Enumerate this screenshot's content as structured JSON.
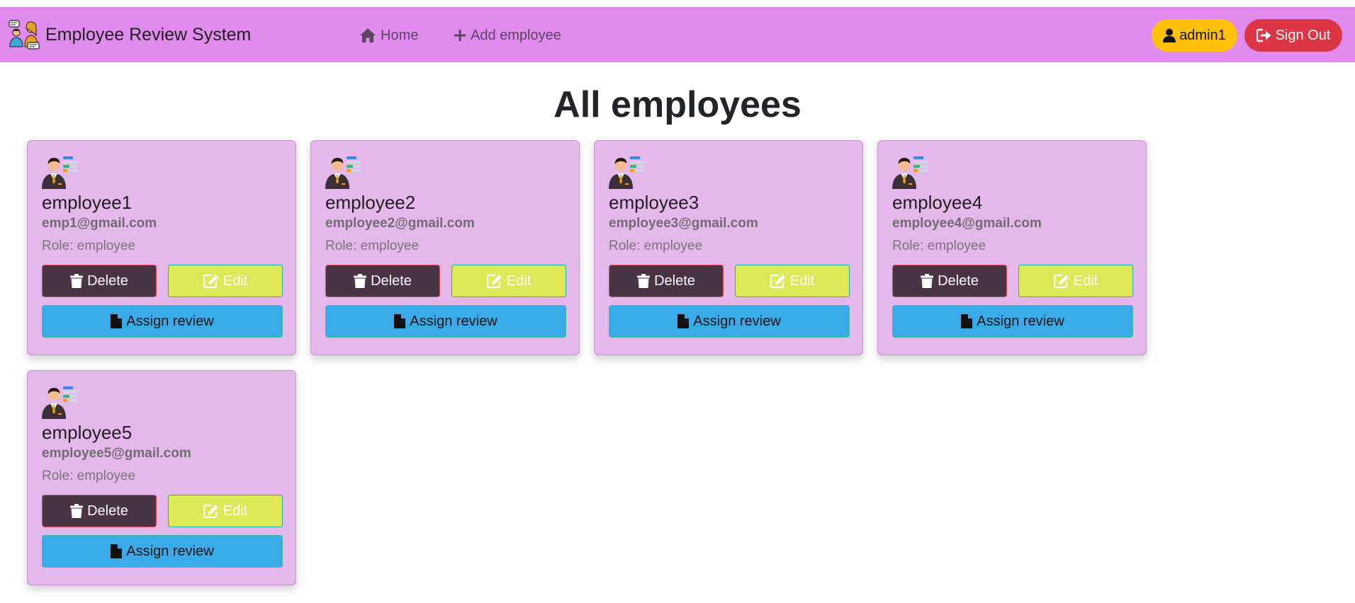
{
  "app": {
    "title": "Employee Review System"
  },
  "nav": {
    "home_label": "Home",
    "add_employee_label": "Add employee",
    "user_label": "admin1",
    "signout_label": "Sign Out"
  },
  "page": {
    "title": "All employees"
  },
  "labels": {
    "delete": "Delete",
    "edit": "Edit",
    "assign": "Assign review"
  },
  "employees": [
    {
      "name": "employee1",
      "email": "emp1@gmail.com",
      "role": "Role: employee"
    },
    {
      "name": "employee2",
      "email": "employee2@gmail.com",
      "role": "Role: employee"
    },
    {
      "name": "employee3",
      "email": "employee3@gmail.com",
      "role": "Role: employee"
    },
    {
      "name": "employee4",
      "email": "employee4@gmail.com",
      "role": "Role: employee"
    },
    {
      "name": "employee5",
      "email": "employee5@gmail.com",
      "role": "Role: employee"
    }
  ],
  "icons": {
    "logo": "people-chat-logo-icon",
    "home": "home-icon",
    "add": "plus-icon",
    "user": "user-icon",
    "signout": "sign-out-icon",
    "avatar": "employee-avatar-icon",
    "delete": "trash-icon",
    "edit": "edit-icon",
    "assign": "file-icon"
  },
  "colors": {
    "navbar": "#e28bee",
    "card": "#e4b8ea",
    "delete": "#483444",
    "edit": "#dee958",
    "assign": "#39abe8",
    "admin": "#fec008",
    "signout": "#dc3545"
  }
}
